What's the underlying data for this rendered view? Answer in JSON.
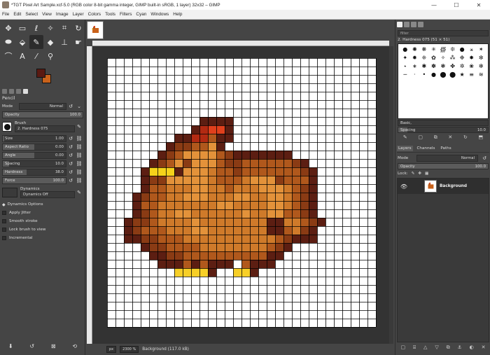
{
  "window": {
    "title": "*TGT Pixel Art Sample.xcf-5.0 (RGB color 8-bit gamma integer, GIMP built-in sRGB, 1 layer) 32x32 – GIMP",
    "minimize": "—",
    "maximize": "☐",
    "close": "✕"
  },
  "menubar": [
    "File",
    "Edit",
    "Select",
    "View",
    "Image",
    "Layer",
    "Colors",
    "Tools",
    "Filters",
    "Cyan",
    "Windows",
    "Help"
  ],
  "toolbox": {
    "tools": [
      {
        "name": "move-tool-icon",
        "glyph": "✥"
      },
      {
        "name": "rect-select-tool-icon",
        "glyph": "▭"
      },
      {
        "name": "lasso-tool-icon",
        "glyph": "ℓ"
      },
      {
        "name": "fuzzy-select-tool-icon",
        "glyph": "✧"
      },
      {
        "name": "crop-tool-icon",
        "glyph": "⌗"
      },
      {
        "name": "rotate-tool-icon",
        "glyph": "↻"
      },
      {
        "name": "warp-tool-icon",
        "glyph": "⬬"
      },
      {
        "name": "bucket-fill-tool-icon",
        "glyph": "⬙"
      },
      {
        "name": "pencil-tool-icon",
        "glyph": "✎"
      },
      {
        "name": "eraser-tool-icon",
        "glyph": "◆"
      },
      {
        "name": "clone-tool-icon",
        "glyph": "⊥"
      },
      {
        "name": "smudge-tool-icon",
        "glyph": "☛"
      },
      {
        "name": "paths-tool-icon",
        "glyph": "⌒"
      },
      {
        "name": "text-tool-icon",
        "glyph": "A"
      },
      {
        "name": "color-picker-tool-icon",
        "glyph": "⁄"
      },
      {
        "name": "zoom-tool-icon",
        "glyph": "⚲"
      }
    ]
  },
  "tool_options": {
    "title": "Pencil",
    "mode_label": "Mode",
    "mode_value": "Normal",
    "opacity_label": "Opacity",
    "opacity_value": "100.0",
    "brush_label": "Brush",
    "brush_value": "2. Hardness 075",
    "size_label": "Size",
    "size_value": "1.00",
    "aspect_label": "Aspect Ratio",
    "aspect_value": "0.00",
    "angle_label": "Angle",
    "angle_value": "0.00",
    "spacing_label": "Spacing",
    "spacing_value": "10.0",
    "hardness_label": "Hardness",
    "hardness_value": "38.0",
    "force_label": "Force",
    "force_value": "100.0",
    "dynamics_label": "Dynamics",
    "dynamics_value": "Dynamics Off",
    "dynamics_options": "Dynamics Options",
    "apply_jitter": "Apply Jitter",
    "smooth_stroke": "Smooth stroke",
    "lock_brush": "Lock brush to view",
    "incremental": "Incremental"
  },
  "status": {
    "unit": "px",
    "zoom": "2300 %",
    "text": "Background (117.0 kB)"
  },
  "brushes": {
    "filter_placeholder": "filter",
    "selected": "2. Hardness 075 (51 × 51)",
    "tag_combo": "Basic,",
    "spacing_label": "Spacing",
    "spacing_value": "10.0",
    "glyphs": [
      "●",
      "✺",
      "❋",
      "✳",
      "∰",
      "❊",
      "●",
      "⚹",
      "✶",
      "✦",
      "✹",
      "❈",
      "✿",
      "✧",
      "⁂",
      "❉",
      "✸",
      "✼",
      "⋆",
      "∗",
      "✱",
      "✽",
      "❃",
      "✤",
      "✲",
      "❀",
      "✻",
      "─",
      "·",
      "•",
      "●",
      "⬤",
      "⬤",
      "★",
      "≡",
      "≋"
    ]
  },
  "layers": {
    "tabs": [
      "Layers",
      "Channels",
      "Paths"
    ],
    "mode_label": "Mode",
    "mode_value": "Normal",
    "opacity_label": "Opacity",
    "opacity_value": "100.0",
    "lock_label": "Lock:",
    "items": [
      {
        "name": "Background"
      }
    ]
  },
  "colors": {
    "foreground": "#5a1a12",
    "background": "#c9621b",
    "outline": "#5c1e12",
    "dark": "#8a3b14",
    "mid": "#b0581c",
    "light": "#cf7a2a",
    "lighter": "#e3923a",
    "comb_dark": "#b22a12",
    "comb": "#e0401c",
    "beak": "#f5d21a",
    "feet": "#f7cf27"
  },
  "pixel_art": {
    "grid_cols": 32,
    "grid_rows": 32,
    "legend": {
      "o": "outline",
      "d": "dark",
      "m": "mid",
      "l": "light",
      "L": "lighter",
      "r": "comb",
      "R": "comb_dark",
      "y": "beak",
      "f": "feet"
    },
    "rows": [
      "................................",
      "................................",
      "................................",
      "................................",
      "................................",
      "................................",
      "................................",
      "...........oooo.................",
      "..........oRrro.................",
      "........ooRRmoo.................",
      ".......oddmmLo..................",
      "......odmLLLLmdooooooo..........",
      ".....odmLdLLLmddmmmmmmdo........",
      "....oyyyoLLLlmmdmmmmmmmdo.......",
      "....oddLLLLLlmmmlLLLdmmmo.......",
      "....ommlllLLllmlllLLLlmdo.......",
      "...odmmllLLLlllLLllLLlmdo.......",
      "...ommlllllllLLllllLLlmdo.......",
      "...odmllLLllllllLllLLmmdo.......",
      "..oddmllllLlllllllloollmdo......",
      "..odmmmlllLLllllllloomldo.......",
      "..ooddmmmlllllllllllmdooo.......",
      "....oddmmmmllllllllmdo..........",
      ".....ooddmmmmmmmmmmoo...........",
      "......ooomomooo.mooo............",
      "........ffffo..ffo..............",
      "................................",
      "................................",
      "................................",
      "................................",
      "................................",
      "................................"
    ]
  }
}
